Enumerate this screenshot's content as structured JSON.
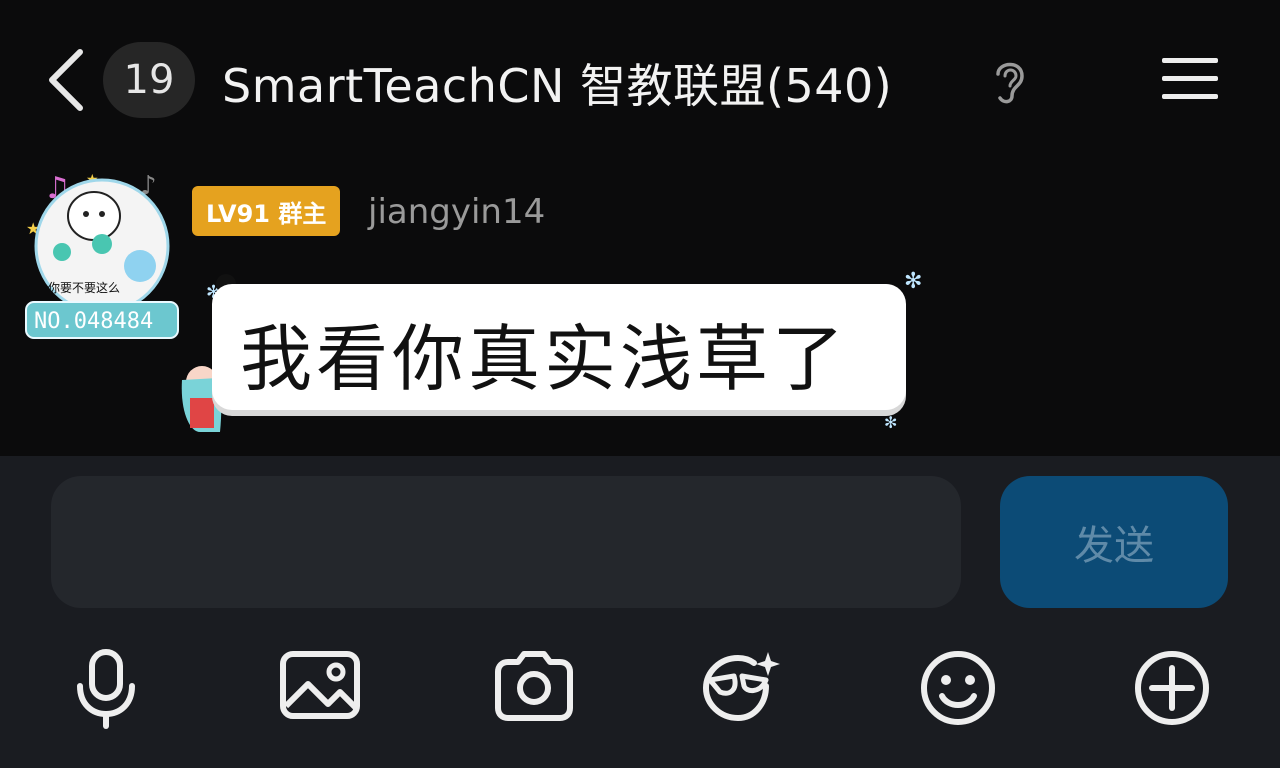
{
  "header": {
    "unread_count": "19",
    "title": "SmartTeachCN 智教联盟(540)",
    "icons": [
      "back-arrow-icon",
      "ear-icon",
      "menu-icon"
    ]
  },
  "message": {
    "avatar_badge": "NO.048484",
    "avatar_caption": "你要不要这么",
    "level_tag": "LV91 群主",
    "username": "jiangyin14",
    "text": "我看你真实浅草了"
  },
  "composer": {
    "input_value": "",
    "send_label": "发送",
    "toolbar": [
      "microphone-icon",
      "image-icon",
      "camera-icon",
      "sticker-icon",
      "emoji-icon",
      "plus-icon"
    ]
  },
  "colors": {
    "background": "#0b0b0c",
    "composer_bg": "#1a1c21",
    "level_tag": "#e5a21f",
    "send_button": "#0c4b76"
  }
}
